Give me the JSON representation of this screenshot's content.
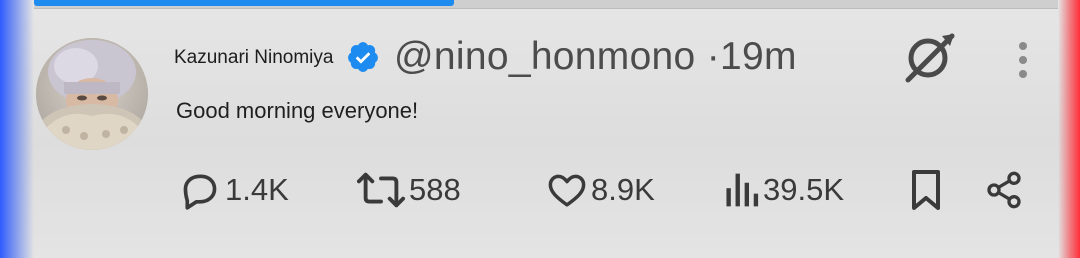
{
  "progress": {
    "fraction": 0.41,
    "color": "#1d8bf0"
  },
  "tweet": {
    "author_name": "Kazunari Ninomiya",
    "handle": "@nino_honmono",
    "separator": "·",
    "time": "19m",
    "text": "Good morning everyone!",
    "verified": true
  },
  "actions": {
    "replies": "1.4K",
    "reposts": "588",
    "likes": "8.9K",
    "views": "39.5K"
  },
  "icons": [
    "verified-badge-icon",
    "grok-icon",
    "more-vertical-icon",
    "reply-icon",
    "repost-icon",
    "like-icon",
    "views-icon",
    "bookmark-icon",
    "share-icon"
  ],
  "colors": {
    "verified": "#1d8bf0",
    "accent": "#1d8bf0"
  }
}
